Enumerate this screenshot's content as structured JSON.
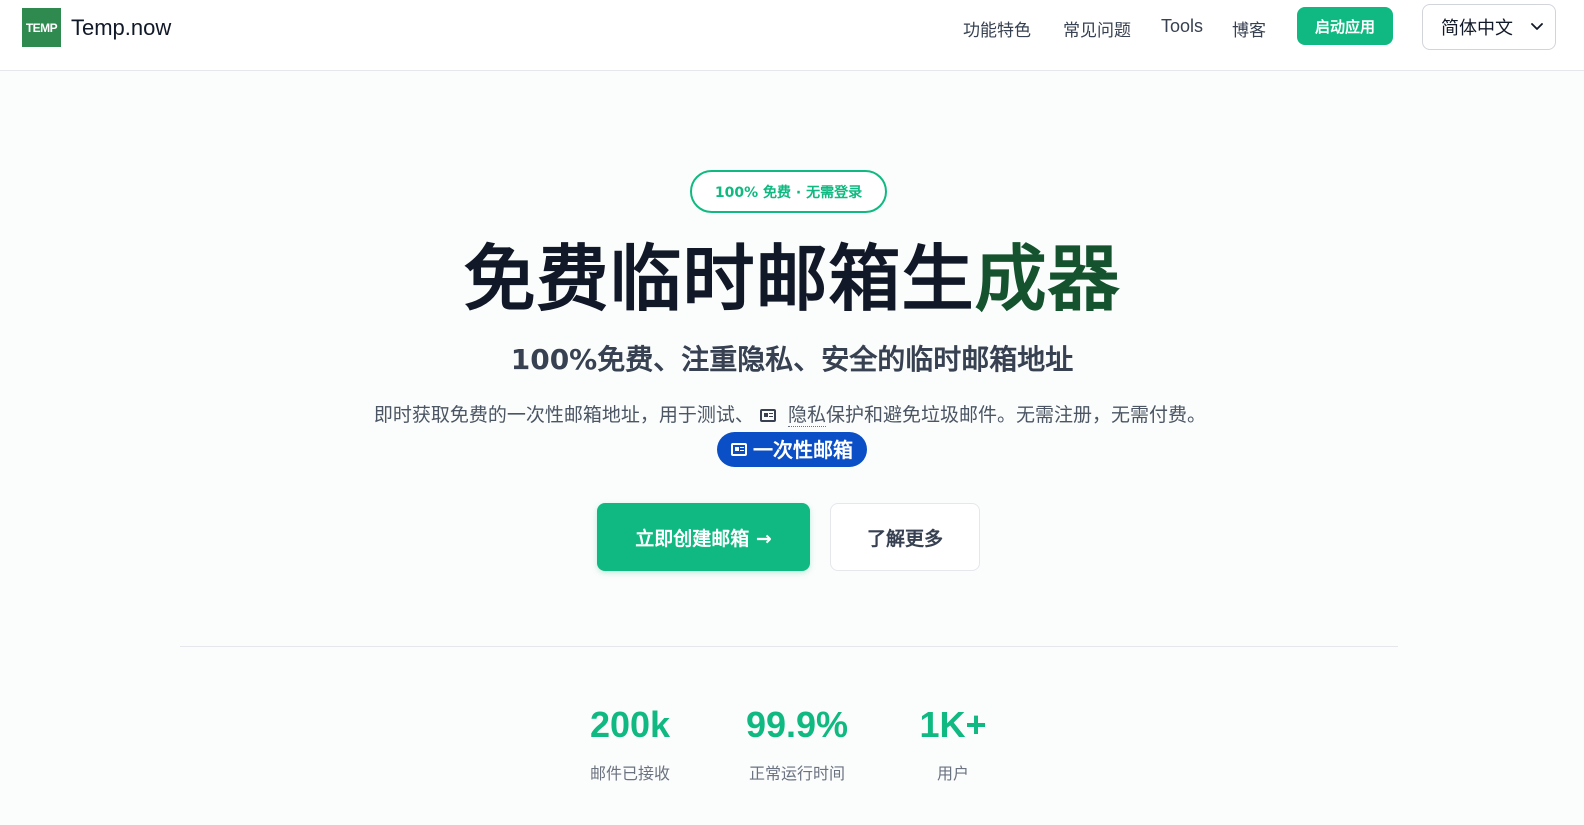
{
  "brand": {
    "logo_text": "TEMP",
    "name": "Temp.now"
  },
  "nav": {
    "features": "功能特色",
    "faq": "常见问题",
    "tools": "Tools",
    "blog": "博客",
    "launch": "启动应用",
    "language": "简体中文"
  },
  "hero": {
    "badge": "100% 免费 · 无需登录",
    "title_main": "免费临时邮箱生",
    "title_accent": "成器",
    "subtitle": "100%免费、注重隐私、安全的临时邮箱地址",
    "desc_part1": "即时获取免费的一次性邮箱地址，用于测试、",
    "desc_link": "隐私",
    "desc_part2": "保护和避免垃圾邮件。无需注册，无需付费。",
    "pill": "一次性邮箱",
    "cta_primary": "立即创建邮箱 →",
    "cta_secondary": "了解更多"
  },
  "stats": [
    {
      "value": "200k",
      "label": "邮件已接收"
    },
    {
      "value": "99.9%",
      "label": "正常运行时间"
    },
    {
      "value": "1K+",
      "label": "用户"
    }
  ],
  "colors": {
    "accent": "#10b981",
    "brand_logo": "#2e8a4e",
    "title_accent": "#14532d",
    "pill": "#0b4fc7"
  },
  "icons": {
    "desc_inline": "card-icon",
    "pill": "card-icon",
    "language": "chevron-down-icon"
  }
}
